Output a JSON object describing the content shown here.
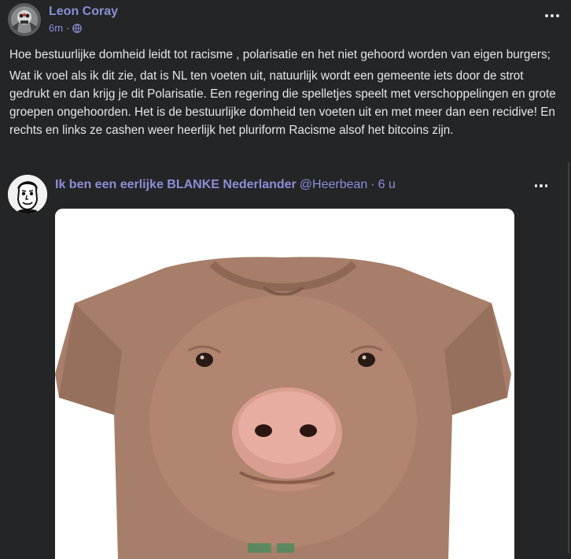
{
  "post": {
    "author": "Leon Coray",
    "time": "6m",
    "separator": "·",
    "paragraphs": [
      "Hoe bestuurlijke domheid leidt tot racisme , polarisatie en het niet gehoord worden van eigen burgers;",
      "Wat ik voel als ik dit zie, dat is NL ten voeten uit, natuurlijk wordt een gemeente iets door de strot gedrukt en dan krijg je dit Polarisatie. Een regering die spelletjes speelt met verschoppelingen en grote groepen ongehoorden. Het is de bestuurlijke domheid ten voeten uit en met meer dan een recidive! En rechts en links ze cashen weer heerlijk het pluriform Racisme alsof het bitcoins zijn."
    ]
  },
  "shared": {
    "name": "Ik ben een eerlijke BLANKE Nederlander",
    "handle": "@Heerbean",
    "separator": "·",
    "time": "6 u"
  },
  "icons": {
    "globe": "globe-icon",
    "more": "more-horizontal-icon"
  },
  "colors": {
    "background": "#242526",
    "link": "#8b8fd8",
    "text": "#e4e6eb",
    "shirt": "#a77e69"
  }
}
